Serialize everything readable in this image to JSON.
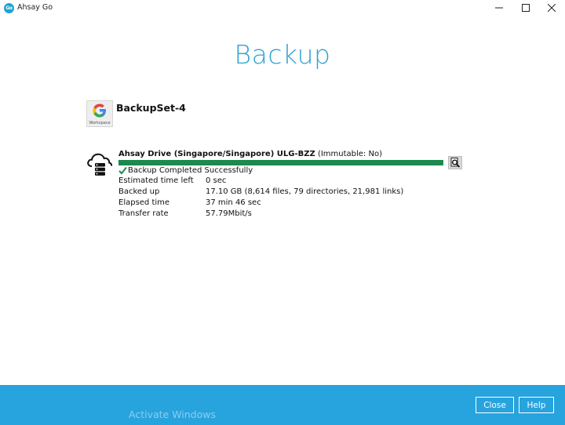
{
  "window": {
    "logo_text": "Go",
    "title": "Ahsay Go"
  },
  "page": {
    "title": "Backup"
  },
  "backup_set": {
    "icon_label": "Workspace",
    "name": "BackupSet-4"
  },
  "destination": {
    "name": "Ahsay Drive (Singapore/Singapore) ULG-BZZ",
    "immutable": "(Immutable: No)",
    "progress_fraction": 1.0,
    "progress_color": "#1a8a4d",
    "status": "Backup Completed Successfully",
    "details": [
      {
        "label": "Estimated time left",
        "value": "0 sec"
      },
      {
        "label": "Backed up",
        "value": "17.10 GB (8,614 files, 79 directories, 21,981 links)"
      },
      {
        "label": "Elapsed time",
        "value": "37 min 46 sec"
      },
      {
        "label": "Transfer rate",
        "value": "57.79Mbit/s"
      }
    ]
  },
  "footer": {
    "watermark": "Activate Windows",
    "close_label": "Close",
    "help_label": "Help",
    "bg_color": "#27a3de"
  },
  "colors": {
    "accent": "#2ea2cf",
    "success": "#1a8a4d"
  }
}
